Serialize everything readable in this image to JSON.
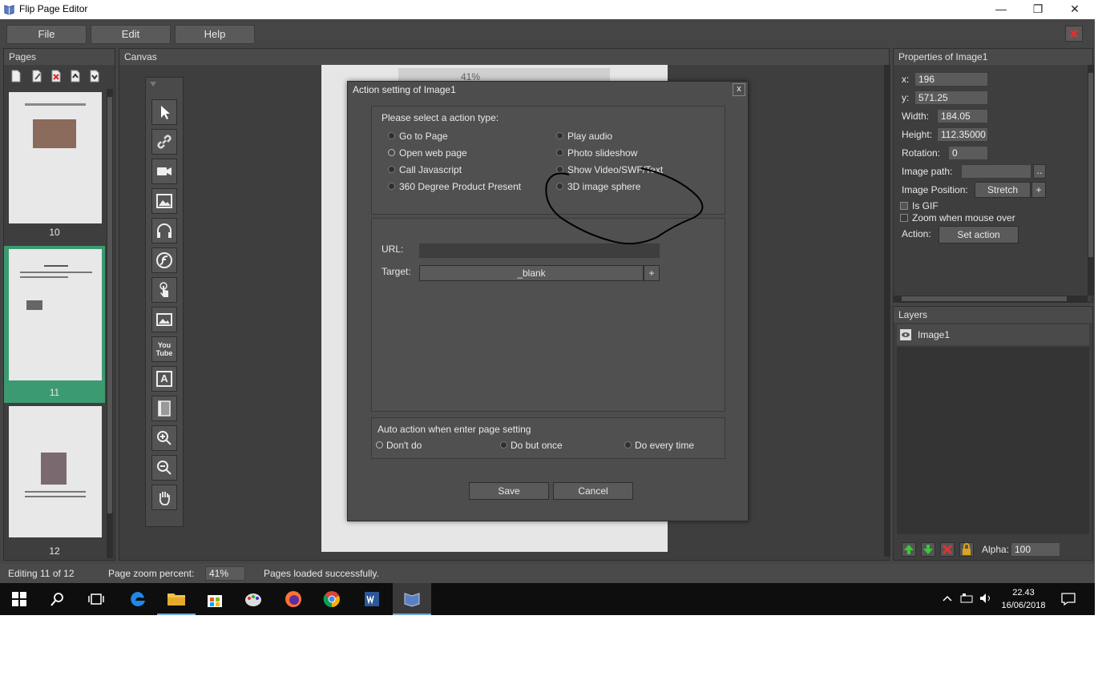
{
  "window": {
    "title": "Flip Page Editor",
    "minimize": "—",
    "restore": "❐",
    "close": "✕"
  },
  "menu": {
    "file": "File",
    "edit": "Edit",
    "help": "Help"
  },
  "pages_panel": {
    "title": "Pages",
    "thumbnails": [
      {
        "number": "10",
        "selected": false
      },
      {
        "number": "11",
        "selected": true
      },
      {
        "number": "12",
        "selected": false
      }
    ]
  },
  "canvas_panel": {
    "title": "Canvas",
    "zoom_text": "41%"
  },
  "tools": [
    "pointer-tool",
    "link-tool",
    "video-tool",
    "image-tool",
    "audio-tool",
    "flash-tool",
    "touch-tool",
    "photo-tool",
    "youtube-tool",
    "text-tool",
    "book-tool",
    "zoom-in-tool",
    "zoom-out-tool",
    "hand-tool"
  ],
  "tool_text": {
    "youtube": "You Tube",
    "text": "A"
  },
  "dialog": {
    "title": "Action setting of Image1",
    "close": "x",
    "select_prompt": "Please select a action type:",
    "action_types": [
      {
        "label": "Go to Page",
        "selected": false
      },
      {
        "label": "Play audio",
        "selected": false
      },
      {
        "label": "Open web page",
        "selected": true
      },
      {
        "label": "Photo slideshow",
        "selected": false
      },
      {
        "label": "Call Javascript",
        "selected": false
      },
      {
        "label": "Show Video/SWF/Text",
        "selected": false
      },
      {
        "label": "360 Degree Product Present",
        "selected": false
      },
      {
        "label": "3D image sphere",
        "selected": false
      }
    ],
    "url_label": "URL:",
    "url_value": "",
    "target_label": "Target:",
    "target_value": "_blank",
    "target_plus": "+",
    "auto_action": {
      "title": "Auto action when enter page setting",
      "options": [
        {
          "label": "Don't do",
          "selected": true
        },
        {
          "label": "Do but once",
          "selected": false
        },
        {
          "label": "Do every time",
          "selected": false
        }
      ]
    },
    "save": "Save",
    "cancel": "Cancel"
  },
  "properties": {
    "title": "Properties of Image1",
    "x_label": "x:",
    "x_value": "196",
    "y_label": "y:",
    "y_value": "571.25",
    "width_label": "Width:",
    "width_value": "184.05",
    "height_label": "Height:",
    "height_value": "112.35000",
    "rotation_label": "Rotation:",
    "rotation_value": "0",
    "image_path_label": "Image path:",
    "image_path_value": "",
    "browse": "..",
    "image_position_label": "Image Position:",
    "image_position_value": "Stretch",
    "image_position_plus": "+",
    "is_gif_label": "Is GIF",
    "zoom_label": "Zoom when mouse over",
    "action_label": "Action:",
    "set_action": "Set action"
  },
  "layers": {
    "title": "Layers",
    "items": [
      {
        "name": "Image1"
      }
    ],
    "alpha_label": "Alpha:",
    "alpha_value": "100"
  },
  "statusbar": {
    "editing": "Editing 11 of 12",
    "zoom_label": "Page zoom percent:",
    "zoom_value": "41%",
    "message": "Pages loaded successfully."
  },
  "taskbar": {
    "time": "22.43",
    "date": "16/06/2018"
  },
  "colors": {
    "app_bg": "#454545",
    "selected_page": "#3c9a70",
    "taskbar": "#0e0e0e"
  }
}
